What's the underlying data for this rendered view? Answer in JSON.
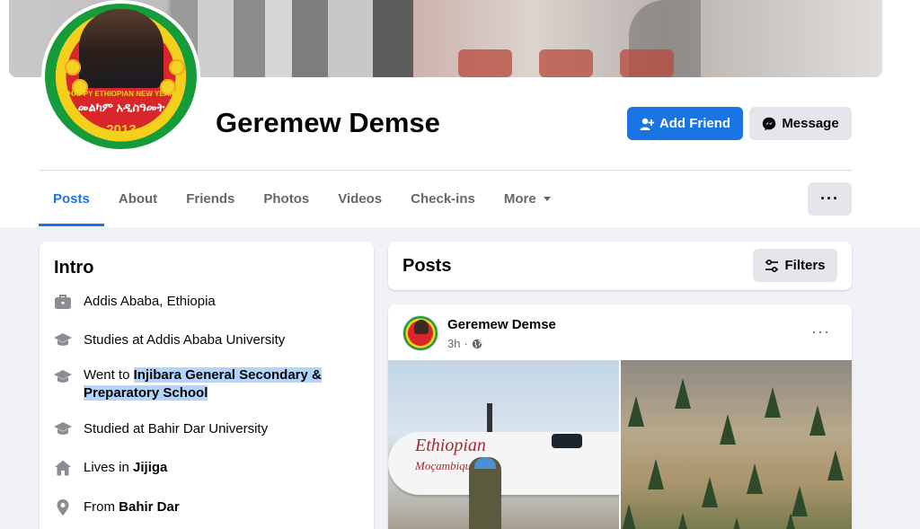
{
  "profile": {
    "name": "Geremew Demse",
    "avatar_banner": "HAPPY ETHIOPIAN NEW YEAR",
    "avatar_amharic": "መልካም አዲስዓመት",
    "avatar_year": "2013"
  },
  "actions": {
    "add_friend": "Add Friend",
    "message": "Message",
    "more_dots": "···"
  },
  "tabs": [
    {
      "label": "Posts",
      "active": true
    },
    {
      "label": "About"
    },
    {
      "label": "Friends"
    },
    {
      "label": "Photos"
    },
    {
      "label": "Videos"
    },
    {
      "label": "Check-ins"
    },
    {
      "label": "More"
    }
  ],
  "intro": {
    "title": "Intro",
    "items": [
      {
        "icon": "briefcase-icon",
        "text": "Addis Ababa, Ethiopia"
      },
      {
        "icon": "graduation-cap-icon",
        "prefix": "Studies at ",
        "bold": "",
        "text": "Studies at Addis Ababa University"
      },
      {
        "icon": "graduation-cap-icon",
        "prefix": "Went to ",
        "bold": "Injibara General Secondary & Preparatory School"
      },
      {
        "icon": "graduation-cap-icon",
        "text": "Studied at Bahir Dar University"
      },
      {
        "icon": "home-icon",
        "prefix": "Lives in ",
        "bold": "Jijiga"
      },
      {
        "icon": "location-pin-icon",
        "prefix": "From ",
        "bold": "Bahir Dar"
      }
    ]
  },
  "posts": {
    "title": "Posts",
    "filters_label": "Filters"
  },
  "post": {
    "author": "Geremew Demse",
    "time": "3h",
    "image_texts": {
      "airline": "Ethiopian",
      "subtitle": "Moçambique"
    }
  },
  "colors": {
    "accent": "#1b74e4",
    "secondary_button": "#e4e6eb",
    "background": "#f0f2f5"
  }
}
